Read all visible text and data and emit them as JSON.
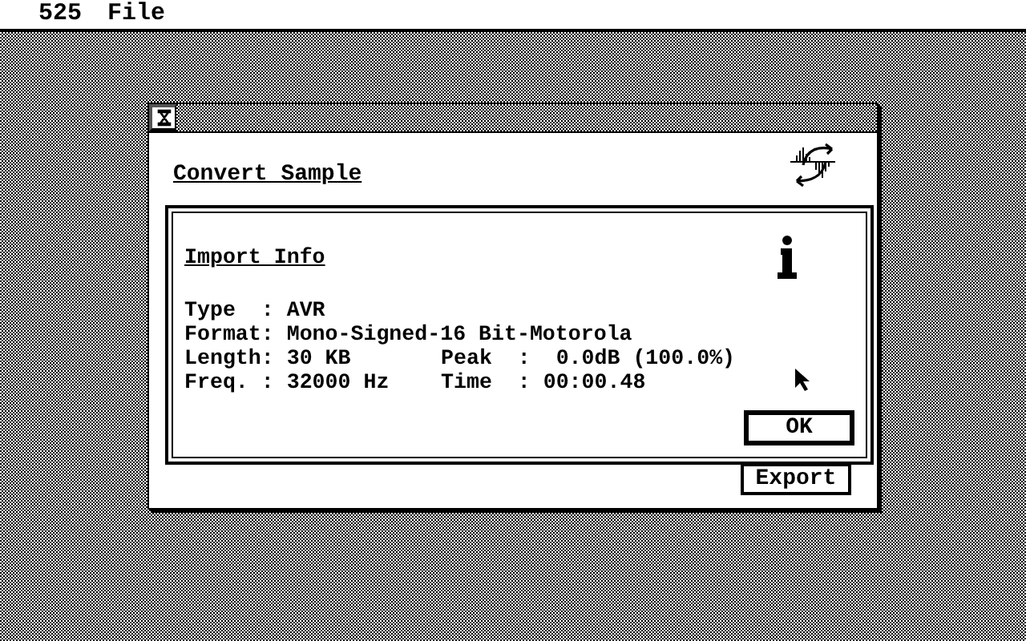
{
  "menu_bar": {
    "items": [
      "525",
      "File"
    ]
  },
  "window": {
    "title": "Convert Sample",
    "buttons": [
      "Export"
    ]
  },
  "dialog": {
    "title": "Import Info",
    "rows": [
      [
        "Type  : AVR"
      ],
      [
        "Format: Mono-Signed-16 Bit-Motorola"
      ],
      [
        "Length: 30 KB",
        "Peak  :  0.0dB (100.0%)"
      ],
      [
        "Freq. : 32000 Hz",
        "Time  : 00:00.48"
      ]
    ],
    "buttons": [
      "OK"
    ]
  }
}
